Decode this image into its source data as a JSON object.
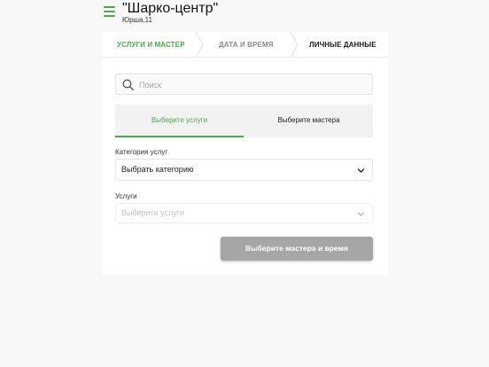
{
  "header": {
    "title": "\"Шарко-центр\"",
    "address": "Юрша,11",
    "menu_icon": "hamburger-menu-icon"
  },
  "steps": [
    {
      "label": "УСЛУГИ И МАСТЕР",
      "state": "active"
    },
    {
      "label": "ДАТА И ВРЕМЯ",
      "state": "inactive"
    },
    {
      "label": "ЛИЧНЫЕ ДАННЫЕ",
      "state": "upcoming"
    }
  ],
  "search": {
    "placeholder": "Поиск",
    "value": ""
  },
  "tabs": [
    {
      "label": "Выберите услуги",
      "active": true
    },
    {
      "label": "Выберите мастера",
      "active": false
    }
  ],
  "category": {
    "label": "Категория услуг",
    "value": "Выбрать категорию"
  },
  "services": {
    "label": "Услуги",
    "placeholder": "Выберите услуги"
  },
  "submit": {
    "label": "Выберите мастера и время",
    "enabled": false
  },
  "colors": {
    "accent": "#4ca94a",
    "disabled_button": "#a6a6a6",
    "background": "#f8f8f8"
  }
}
